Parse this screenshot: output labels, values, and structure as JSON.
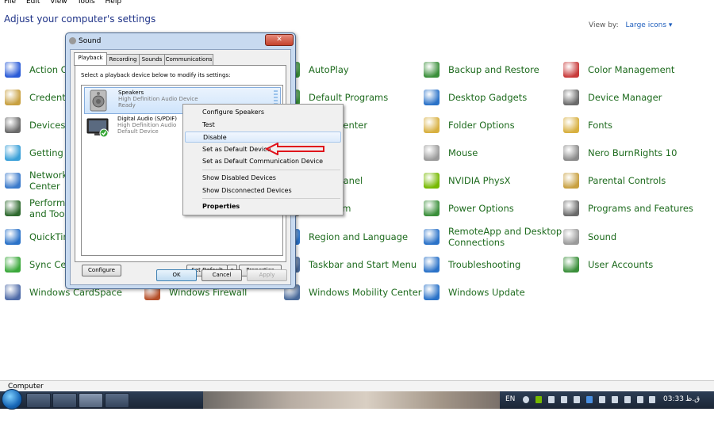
{
  "menubar": {
    "items": [
      "File",
      "Edit",
      "View",
      "Tools",
      "Help"
    ]
  },
  "control_panel": {
    "title": "Adjust your computer's settings",
    "view_by_label": "View by:",
    "view_by_value": "Large icons ▾",
    "items": [
      {
        "label": "Action Ce",
        "icon": "flag-icon",
        "color": "#2a5bd7"
      },
      {
        "label": "Credentia",
        "icon": "credential-icon",
        "color": "#c8a040"
      },
      {
        "label": "Devices a",
        "icon": "devices-icon",
        "color": "#6a6a6a"
      },
      {
        "label": "Getting S",
        "icon": "getting-started-icon",
        "color": "#3aa0d8"
      },
      {
        "label": "Network\nCenter",
        "icon": "network-icon",
        "color": "#3a7acb"
      },
      {
        "label": "Performa\nand Tools",
        "icon": "performance-icon",
        "color": "#2f6a2f"
      },
      {
        "label": "QuickTim",
        "icon": "quicktime-icon",
        "color": "#2a72c8"
      },
      {
        "label": "Sync Cen",
        "icon": "sync-icon",
        "color": "#3aa83a"
      },
      {
        "label": "Windows CardSpace",
        "icon": "cardspace-icon",
        "color": "#4f6ba8"
      },
      {
        "label": "Windows Firewall",
        "icon": "firewall-icon",
        "color": "#b5502a"
      },
      {
        "label": "AutoPlay",
        "icon": "autoplay-icon",
        "color": "#3a8f3a"
      },
      {
        "label": "Default Programs",
        "icon": "default-programs-icon",
        "color": "#3a8f3a"
      },
      {
        "label": "ccess Center",
        "icon": "ease-access-icon",
        "color": "#2a72c8"
      },
      {
        "label": "ontrol Panel",
        "icon": "control-panel-icon",
        "color": "#2a72c8"
      },
      {
        "label": "d Modem",
        "icon": "modem-icon",
        "color": "#777777"
      },
      {
        "label": "Region and Language",
        "icon": "globe-icon",
        "color": "#2a72c8"
      },
      {
        "label": "Taskbar and Start Menu",
        "icon": "taskbar-icon",
        "color": "#4a6a9a"
      },
      {
        "label": "Windows Mobility Center",
        "icon": "mobility-icon",
        "color": "#4a6a9a"
      },
      {
        "label": "Backup and Restore",
        "icon": "backup-icon",
        "color": "#3a8f3a"
      },
      {
        "label": "Desktop Gadgets",
        "icon": "gadgets-icon",
        "color": "#2a72c8"
      },
      {
        "label": "Folder Options",
        "icon": "folder-icon",
        "color": "#d8b040"
      },
      {
        "label": "Mouse",
        "icon": "mouse-icon",
        "color": "#9a9a9a"
      },
      {
        "label": "NVIDIA PhysX",
        "icon": "nvidia-icon",
        "color": "#76b900"
      },
      {
        "label": "Power Options",
        "icon": "power-icon",
        "color": "#3a8f3a"
      },
      {
        "label": "RemoteApp and Desktop\nConnections",
        "icon": "remoteapp-icon",
        "color": "#2a72c8"
      },
      {
        "label": "Troubleshooting",
        "icon": "troubleshooting-icon",
        "color": "#2a72c8"
      },
      {
        "label": "Windows Update",
        "icon": "windows-update-icon",
        "color": "#2a72c8"
      },
      {
        "label": "Color Management",
        "icon": "color-management-icon",
        "color": "#c83a3a"
      },
      {
        "label": "Device Manager",
        "icon": "device-manager-icon",
        "color": "#6a6a6a"
      },
      {
        "label": "Fonts",
        "icon": "fonts-icon",
        "color": "#d8b040"
      },
      {
        "label": "Nero BurnRights 10",
        "icon": "nero-icon",
        "color": "#8a8a8a"
      },
      {
        "label": "Parental Controls",
        "icon": "parental-controls-icon",
        "color": "#c8a040"
      },
      {
        "label": "Programs and Features",
        "icon": "programs-icon",
        "color": "#6a6a6a"
      },
      {
        "label": "Sound",
        "icon": "sound-icon",
        "color": "#9a9a9a"
      },
      {
        "label": "User Accounts",
        "icon": "user-accounts-icon",
        "color": "#3a8f3a"
      }
    ]
  },
  "dialog": {
    "title": "Sound",
    "close_label": "✕",
    "tabs": [
      "Playback",
      "Recording",
      "Sounds",
      "Communications"
    ],
    "active_tab": "Playback",
    "instruction": "Select a playback device below to modify its settings:",
    "devices": [
      {
        "name": "Speakers",
        "driver": "High Definition Audio Device",
        "status": "Ready",
        "icon": "speaker-icon",
        "selected": true
      },
      {
        "name": "Digital Audio (S/PDIF)",
        "driver": "High Definition Audio",
        "status": "Default Device",
        "icon": "monitor-icon",
        "selected": false
      }
    ],
    "buttons": {
      "configure": "Configure",
      "set_default": "Set Default",
      "set_default_arrow": "▾",
      "properties": "Properties",
      "ok": "OK",
      "cancel": "Cancel",
      "apply": "Apply"
    }
  },
  "context_menu": {
    "items": [
      {
        "label": "Configure Speakers"
      },
      {
        "label": "Test"
      },
      {
        "label": "Disable",
        "highlighted": true
      },
      {
        "label": "Set as Default Device"
      },
      {
        "label": "Set as Default Communication Device"
      },
      {
        "label": "Show Disabled Devices"
      },
      {
        "label": "Show Disconnected Devices"
      },
      {
        "label": "Properties",
        "bold": true
      }
    ]
  },
  "statusbar": {
    "text": "Computer"
  },
  "taskbar": {
    "tray": {
      "language": "EN",
      "time": "03:33",
      "ampm": "ق.ظ"
    }
  },
  "colors": {
    "link_green": "#1e6b1e",
    "title_blue": "#1e3287",
    "annotation_arrow": "#e0101a"
  }
}
